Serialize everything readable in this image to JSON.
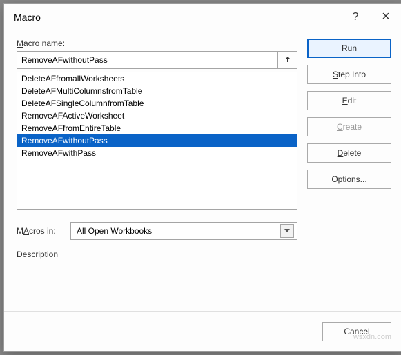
{
  "window": {
    "title": "Macro",
    "help_icon": "?",
    "close_icon": "×"
  },
  "macro_name": {
    "label": "Macro name:",
    "underline_char": "M",
    "value": "RemoveAFwithoutPass"
  },
  "macro_list": {
    "items": [
      "DeleteAFfromallWorksheets",
      "DeleteAFMultiColumnsfromTable",
      "DeleteAFSingleColumnfromTable",
      "RemoveAFActiveWorksheet",
      "RemoveAFfromEntireTable",
      "RemoveAFwithoutPass",
      "RemoveAFwithPass"
    ],
    "selected_index": 5
  },
  "macros_in": {
    "label": "Macros in:",
    "underline_char": "A",
    "value": "All Open Workbooks"
  },
  "description": {
    "label": "Description"
  },
  "buttons": {
    "run": "Run",
    "run_underline": "R",
    "step_into": "Step Into",
    "step_underline": "S",
    "edit": "Edit",
    "edit_underline": "E",
    "create": "Create",
    "create_underline": "C",
    "delete": "Delete",
    "delete_underline": "D",
    "options": "Options...",
    "options_underline": "O",
    "cancel": "Cancel"
  },
  "watermark": "wsxdn.com"
}
